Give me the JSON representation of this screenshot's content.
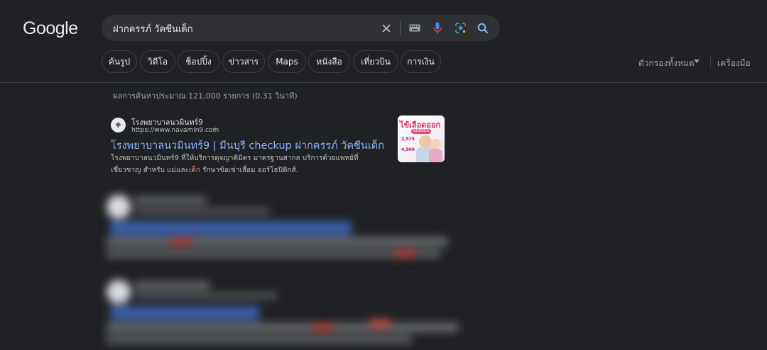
{
  "logo": "Google",
  "search": {
    "query": "ฝากครรภ์ วัคซีนเด็ก"
  },
  "chips": [
    "ค้นรูป",
    "วิดีโอ",
    "ช็อปปิ้ง",
    "ข่าวสาร",
    "Maps",
    "หนังสือ",
    "เที่ยวบิน",
    "การเงิน"
  ],
  "filters": {
    "all_filters": "ตัวกรองทั้งหมด",
    "tools": "เครื่องมือ"
  },
  "stats": "ผลการค้นหาประมาณ 121,000 รายการ (0.31 วินาที)",
  "result": {
    "site_name": "โรงพยาบาลนวมินทร์9",
    "url": "https://www.navamin9.com",
    "title": "โรงพยาบาลนวมินทร์9 | มีนบุรี checkup ฝากครรภ์ วัคซีนเด็ก",
    "snippet_before": "โรงพยาบาลนวมินทร์9 ที่ให้บริการดุจญาติมิตร มาตรฐานสากล บริการด้วยแพทย์ที่เชี่ยวชาญ สำหรับ แม่และ",
    "snippet_highlight": "เด็ก",
    "snippet_after": " รักษาข้อเข่าเสื่อม ออร์โธปิดิกส์.",
    "thumbnail": {
      "headline": "ไข้เลือดออก",
      "tag": "QDENGA",
      "price1": "2,575",
      "price2": "4,900"
    }
  },
  "colors": {
    "background": "#202124",
    "link": "#8ab4f8",
    "highlight": "#f28b82",
    "surface": "#303134"
  }
}
